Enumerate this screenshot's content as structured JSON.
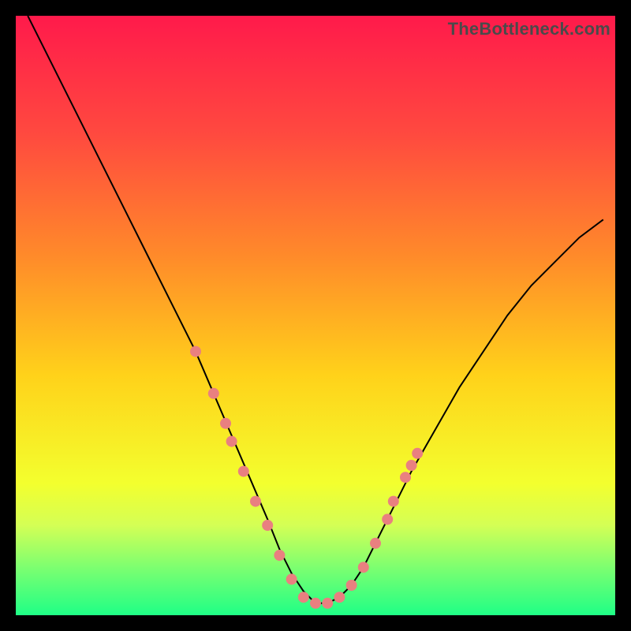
{
  "watermark": "TheBottleneck.com",
  "chart_data": {
    "type": "line",
    "title": "",
    "xlabel": "",
    "ylabel": "",
    "xlim": [
      0,
      100
    ],
    "ylim": [
      0,
      100
    ],
    "background_gradient": {
      "stops": [
        {
          "offset": 0,
          "color": "#ff1a4b"
        },
        {
          "offset": 20,
          "color": "#ff4a3f"
        },
        {
          "offset": 40,
          "color": "#ff8a2a"
        },
        {
          "offset": 60,
          "color": "#ffd21a"
        },
        {
          "offset": 78,
          "color": "#f3ff2e"
        },
        {
          "offset": 85,
          "color": "#d4ff55"
        },
        {
          "offset": 92,
          "color": "#7dff70"
        },
        {
          "offset": 100,
          "color": "#1fff86"
        }
      ]
    },
    "series": [
      {
        "name": "bottleneck-curve",
        "color": "#000000",
        "width": 2,
        "x": [
          2,
          6,
          10,
          14,
          18,
          22,
          26,
          30,
          33,
          36,
          39,
          42,
          44,
          46,
          48,
          50,
          52,
          54,
          56,
          58,
          60,
          63,
          66,
          70,
          74,
          78,
          82,
          86,
          90,
          94,
          98
        ],
        "y": [
          100,
          92,
          84,
          76,
          68,
          60,
          52,
          44,
          37,
          30,
          23,
          16,
          11,
          7,
          4,
          2,
          2,
          3,
          5,
          8,
          12,
          18,
          24,
          31,
          38,
          44,
          50,
          55,
          59,
          63,
          66
        ]
      }
    ],
    "markers": {
      "name": "highlight-dots",
      "color": "#e98080",
      "radius": 7,
      "points": [
        {
          "x": 30,
          "y": 44
        },
        {
          "x": 33,
          "y": 37
        },
        {
          "x": 35,
          "y": 32
        },
        {
          "x": 36,
          "y": 29
        },
        {
          "x": 38,
          "y": 24
        },
        {
          "x": 40,
          "y": 19
        },
        {
          "x": 42,
          "y": 15
        },
        {
          "x": 44,
          "y": 10
        },
        {
          "x": 46,
          "y": 6
        },
        {
          "x": 48,
          "y": 3
        },
        {
          "x": 50,
          "y": 2
        },
        {
          "x": 52,
          "y": 2
        },
        {
          "x": 54,
          "y": 3
        },
        {
          "x": 56,
          "y": 5
        },
        {
          "x": 58,
          "y": 8
        },
        {
          "x": 60,
          "y": 12
        },
        {
          "x": 62,
          "y": 16
        },
        {
          "x": 63,
          "y": 19
        },
        {
          "x": 65,
          "y": 23
        },
        {
          "x": 66,
          "y": 25
        },
        {
          "x": 67,
          "y": 27
        }
      ]
    }
  }
}
